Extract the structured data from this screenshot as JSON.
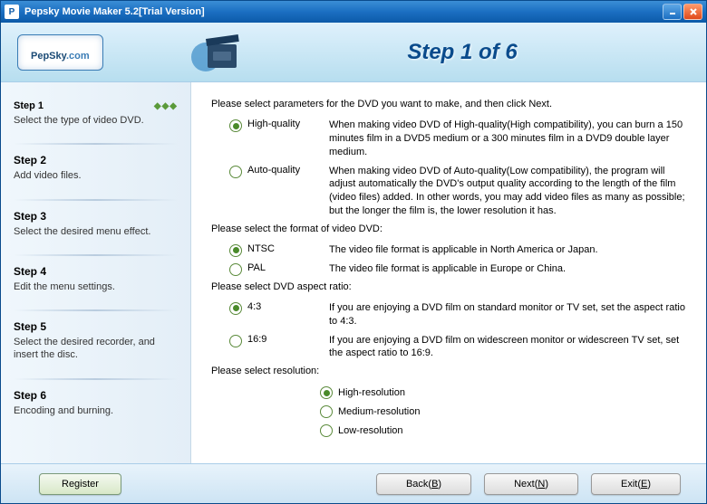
{
  "window": {
    "title": "Pepsky Movie Maker 5.2[Trial Version]"
  },
  "logo": {
    "brand": "PepSky",
    "suffix": ".com"
  },
  "header": {
    "title": "Step 1 of 6"
  },
  "sidebar": {
    "steps": [
      {
        "title": "Step 1",
        "desc": "Select the type of video DVD.",
        "active": true
      },
      {
        "title": "Step 2",
        "desc": "Add video files."
      },
      {
        "title": "Step 3",
        "desc": "Select the desired menu effect."
      },
      {
        "title": "Step 4",
        "desc": "Edit the menu settings."
      },
      {
        "title": "Step 5",
        "desc": "Select the desired recorder, and insert the disc."
      },
      {
        "title": "Step 6",
        "desc": "Encoding and burning."
      }
    ]
  },
  "content": {
    "intro": "Please select parameters for the DVD you want to make, and then click Next.",
    "quality": {
      "options": [
        {
          "label": "High-quality",
          "desc": "When making video DVD of High-quality(High compatibility), you can burn a 150 minutes film in a DVD5 medium or a 300 minutes film in a DVD9 double layer medium.",
          "selected": true
        },
        {
          "label": "Auto-quality",
          "desc": "When making video DVD of Auto-quality(Low compatibility), the program will adjust automatically the DVD's output quality according to the length of the film (video files) added. In other words, you may add video files as many as possible; but the longer the film is, the lower resolution it has.",
          "selected": false
        }
      ]
    },
    "format": {
      "prompt": "Please select the format of video DVD:",
      "options": [
        {
          "label": "NTSC",
          "desc": "The video file format is applicable in North America or Japan.",
          "selected": true
        },
        {
          "label": "PAL",
          "desc": "The video file format is applicable in Europe or China.",
          "selected": false
        }
      ]
    },
    "aspect": {
      "prompt": "Please select DVD aspect ratio:",
      "options": [
        {
          "label": "4:3",
          "desc": "If you are enjoying a DVD film on standard monitor or TV set, set the aspect ratio to 4:3.",
          "selected": true
        },
        {
          "label": "16:9",
          "desc": "If you are enjoying a DVD film on widescreen monitor or widescreen TV set, set the aspect ratio to 16:9.",
          "selected": false
        }
      ]
    },
    "resolution": {
      "prompt": "Please select resolution:",
      "options": [
        {
          "label": "High-resolution",
          "selected": true
        },
        {
          "label": "Medium-resolution",
          "selected": false
        },
        {
          "label": "Low-resolution",
          "selected": false
        }
      ]
    }
  },
  "footer": {
    "register": "Register",
    "back": "Back(",
    "back_u": "B",
    "back_e": ")",
    "next": "Next(",
    "next_u": "N",
    "next_e": ")",
    "exit": "Exit(",
    "exit_u": "E",
    "exit_e": ")"
  }
}
